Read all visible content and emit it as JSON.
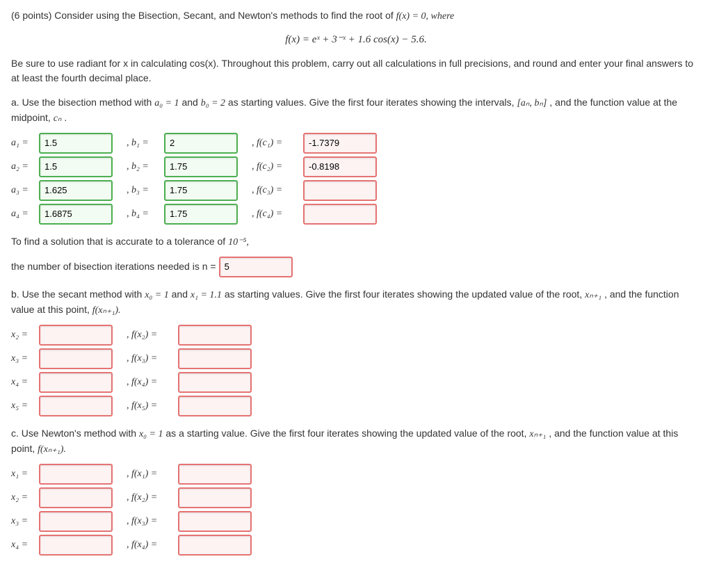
{
  "header": {
    "points_prefix": "(6 points) Consider using the Bisection, Secant, and Newton's methods to find the root of ",
    "equation_inline": "f(x) = 0, where",
    "equation_display": "f(x) = eˣ + 3⁻ˣ + 1.6 cos(x) − 5.6.",
    "instructions": "Be sure to use radiant for x in calculating cos(x). Throughout this problem, carry out all calculations in full precisions, and round and enter your final answers to at least the fourth decimal place."
  },
  "part_a": {
    "text_1": "a. Use the bisection method with ",
    "a0": "a₀ = 1",
    "and": " and ",
    "b0": "b₀ = 2",
    "text_2": " as starting values. Give the first four iterates showing the intervals, ",
    "interval": "[aₙ, bₙ]",
    "text_3": ", and the function value at the midpoint, ",
    "cn": "cₙ",
    "period": ".",
    "rows": [
      {
        "a_label": "a₁ =",
        "a_val": "1.5",
        "a_state": "correct",
        "b_label": ", b₁ =",
        "b_val": "2",
        "b_state": "correct",
        "f_label": ", f(c₁) =",
        "f_val": "-1.7379",
        "f_state": "incorrect"
      },
      {
        "a_label": "a₂ =",
        "a_val": "1.5",
        "a_state": "correct",
        "b_label": ", b₂ =",
        "b_val": "1.75",
        "b_state": "correct",
        "f_label": ", f(c₂) =",
        "f_val": "-0.8198",
        "f_state": "incorrect"
      },
      {
        "a_label": "a₃ =",
        "a_val": "1.625",
        "a_state": "correct",
        "b_label": ", b₃ =",
        "b_val": "1.75",
        "b_state": "correct",
        "f_label": ", f(c₃) =",
        "f_val": "",
        "f_state": "empty"
      },
      {
        "a_label": "a₄ =",
        "a_val": "1.6875",
        "a_state": "correct",
        "b_label": ", b₄ =",
        "b_val": "1.75",
        "b_state": "correct",
        "f_label": ", f(c₄) =",
        "f_val": "",
        "f_state": "empty"
      }
    ],
    "tolerance_text_1": "To find a solution that is accurate to a tolerance of ",
    "tolerance_value": "10⁻⁵,",
    "iterations_text": "the number of bisection iterations needed is n = ",
    "n_val": "5",
    "n_state": "incorrect"
  },
  "part_b": {
    "text_1": "b. Use the secant method with ",
    "x0": "x₀ = 1",
    "and": " and ",
    "x1": "x₁ = 1.1",
    "text_2": " as starting values. Give the first four iterates showing the updated value of the root, ",
    "xn1": "xₙ₊₁",
    "text_3": ", and the function value at this point, ",
    "fxn1": "f(xₙ₊₁).",
    "rows": [
      {
        "x_label": "x₂ =",
        "f_label": ", f(x₂) ="
      },
      {
        "x_label": "x₃ =",
        "f_label": ", f(x₃) ="
      },
      {
        "x_label": "x₄ =",
        "f_label": ", f(x₄) ="
      },
      {
        "x_label": "x₅ =",
        "f_label": ", f(x₅) ="
      }
    ]
  },
  "part_c": {
    "text_1": "c. Use Newton's method with ",
    "x0": "x₀ = 1",
    "text_2": " as a starting value. Give the first four iterates showing the updated value of the root, ",
    "xn1": "xₙ₊₁",
    "text_3": ", and the function value at this point, ",
    "fxn1": "f(xₙ₊₁).",
    "rows": [
      {
        "x_label": "x₁ =",
        "f_label": ", f(x₁) ="
      },
      {
        "x_label": "x₂ =",
        "f_label": ", f(x₂) ="
      },
      {
        "x_label": "x₃ =",
        "f_label": ", f(x₃) ="
      },
      {
        "x_label": "x₄ =",
        "f_label": ", f(x₄) ="
      }
    ]
  }
}
